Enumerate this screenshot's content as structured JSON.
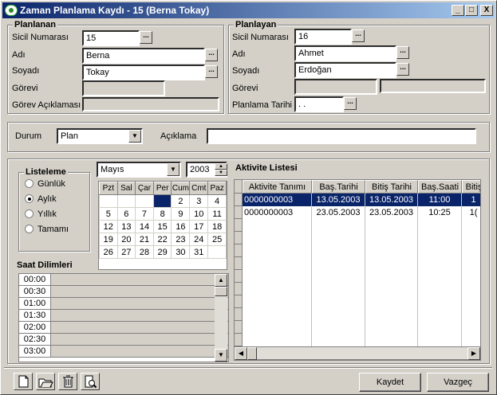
{
  "window": {
    "title": "Zaman Planlama Kaydı - 15 (Berna Tokay)",
    "min": "_",
    "max": "□",
    "close": "X"
  },
  "planlanan": {
    "title": "Planlanan",
    "sicil_label": "Sicil Numarası",
    "sicil": "15",
    "adi_label": "Adı",
    "adi": "Berna",
    "soyadi_label": "Soyadı",
    "soyadi": "Tokay",
    "gorevi_label": "Görevi",
    "gorevi": "",
    "aciklama_label": "Görev Açıklaması",
    "aciklama": ""
  },
  "planlayan": {
    "title": "Planlayan",
    "sicil_label": "Sicil Numarası",
    "sicil": "16",
    "adi_label": "Adı",
    "adi": "Ahmet",
    "soyadi_label": "Soyadı",
    "soyadi": "Erdoğan",
    "gorevi_label": "Görevi",
    "gorevi": "",
    "tarih_label": "Planlama Tarihi",
    "tarih": " .  ."
  },
  "ellipsis": "...",
  "durum": {
    "label": "Durum",
    "value": "Plan",
    "aciklama_label": "Açıklama",
    "aciklama": ""
  },
  "listeleme": {
    "title": "Listeleme",
    "options": [
      "Günlük",
      "Aylık",
      "Yıllık",
      "Tamamı"
    ],
    "selected": "Aylık"
  },
  "calendar": {
    "month": "Mayıs",
    "year": "2003",
    "days_header": [
      "Pzt",
      "Sal",
      "Çar",
      "Per",
      "Cum",
      "Cmt",
      "Paz"
    ],
    "weeks": [
      [
        "",
        "",
        "",
        "",
        "2",
        "3",
        "4"
      ],
      [
        "5",
        "6",
        "7",
        "8",
        "9",
        "10",
        "11"
      ],
      [
        "12",
        "13",
        "14",
        "15",
        "16",
        "17",
        "18"
      ],
      [
        "19",
        "20",
        "21",
        "22",
        "23",
        "24",
        "25"
      ],
      [
        "26",
        "27",
        "28",
        "29",
        "30",
        "31",
        ""
      ]
    ],
    "selected_day": "1"
  },
  "saat": {
    "title": "Saat Dilimleri",
    "times": [
      "00:00",
      "00:30",
      "01:00",
      "01:30",
      "02:00",
      "02:30",
      "03:00"
    ]
  },
  "aktivite": {
    "title": "Aktivite Listesi",
    "columns": [
      "Aktivite Tanımı",
      "Baş.Tarihi",
      "Bitiş Tarihi",
      "Baş.Saati",
      "Bitiş"
    ],
    "rows": [
      [
        "0000000003",
        "13.05.2003",
        "13.05.2003",
        "11:00",
        "1"
      ],
      [
        "0000000003",
        "23.05.2003",
        "23.05.2003",
        "10:25",
        "1("
      ]
    ]
  },
  "buttons": {
    "kaydet": "Kaydet",
    "vazgec": "Vazgeç"
  },
  "colors": {
    "title_start": "#0a246a",
    "title_end": "#a6caf0",
    "selection": "#0a246a",
    "face": "#d4d0c8"
  }
}
